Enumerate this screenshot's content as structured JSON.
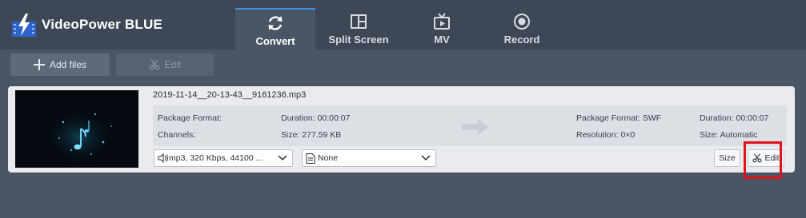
{
  "app": {
    "title": "VideoPower BLUE"
  },
  "tabs": [
    {
      "label": "Convert",
      "icon": "refresh-icon",
      "active": true
    },
    {
      "label": "Split Screen",
      "icon": "split-screen-icon",
      "active": false
    },
    {
      "label": "MV",
      "icon": "tv-icon",
      "active": false
    },
    {
      "label": "Record",
      "icon": "record-icon",
      "active": false
    }
  ],
  "toolbar": {
    "add_files": "Add files",
    "edit": "Edit"
  },
  "file": {
    "name": "2019-11-14__20-13-43__9161236.mp3",
    "source": {
      "package_format": "Package Format:",
      "channels": "Channels:",
      "duration": "Duration: 00:00:07",
      "size": "Size: 277.59 KB"
    },
    "target": {
      "package_format": "Package Format: SWF",
      "resolution": "Resolution: 0×0",
      "duration": "Duration: 00:00:07",
      "size": "Size: Automatic"
    },
    "audio_select": "mp3, 320 Kbps, 44100 ...",
    "subtitle_select": "None",
    "size_button": "Size",
    "edit_button": "Edit"
  },
  "colors": {
    "accent": "#3b8fe0",
    "highlight": "#e0121a",
    "background": "#4a5566",
    "header": "#3d4756"
  }
}
